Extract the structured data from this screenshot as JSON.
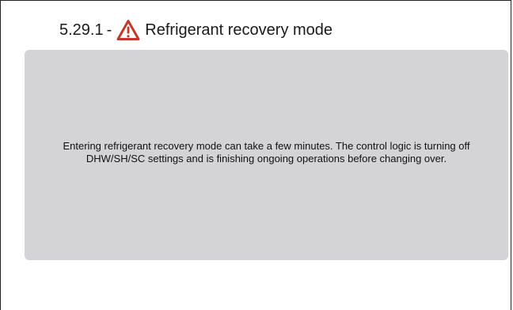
{
  "header": {
    "section_number": "5.29.1",
    "separator": "-",
    "title": "Refrigerant recovery mode",
    "icon": "warning-triangle-icon",
    "icon_color": "#c0392b"
  },
  "panel": {
    "message": "Entering refrigerant recovery mode can take a few minutes. The control logic is turning off DHW/SH/SC settings and is finishing ongoing operations before changing over.",
    "background": "#d4d4d6"
  }
}
